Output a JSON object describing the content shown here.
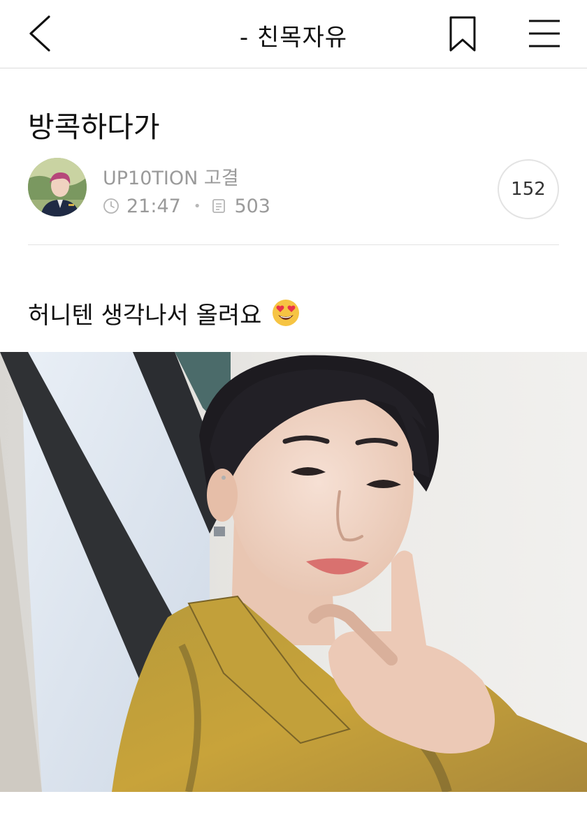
{
  "header": {
    "board_name": "- 친목자유",
    "back_icon": "chevron-left-icon",
    "bookmark_icon": "bookmark-icon",
    "menu_icon": "hamburger-menu-icon"
  },
  "post": {
    "title": "방콕하다가",
    "author": "UP10TION 고결",
    "time": "21:47",
    "views": "503",
    "comment_count": "152",
    "body": "허니텐 생각나서 올려요",
    "body_emoji": "heart-eyes-emoji",
    "photo": "selfie-photo"
  },
  "colors": {
    "meta_gray": "#9a9a9a",
    "divider": "#e3e3e3",
    "jacket_yellow": "#c8a33a"
  }
}
